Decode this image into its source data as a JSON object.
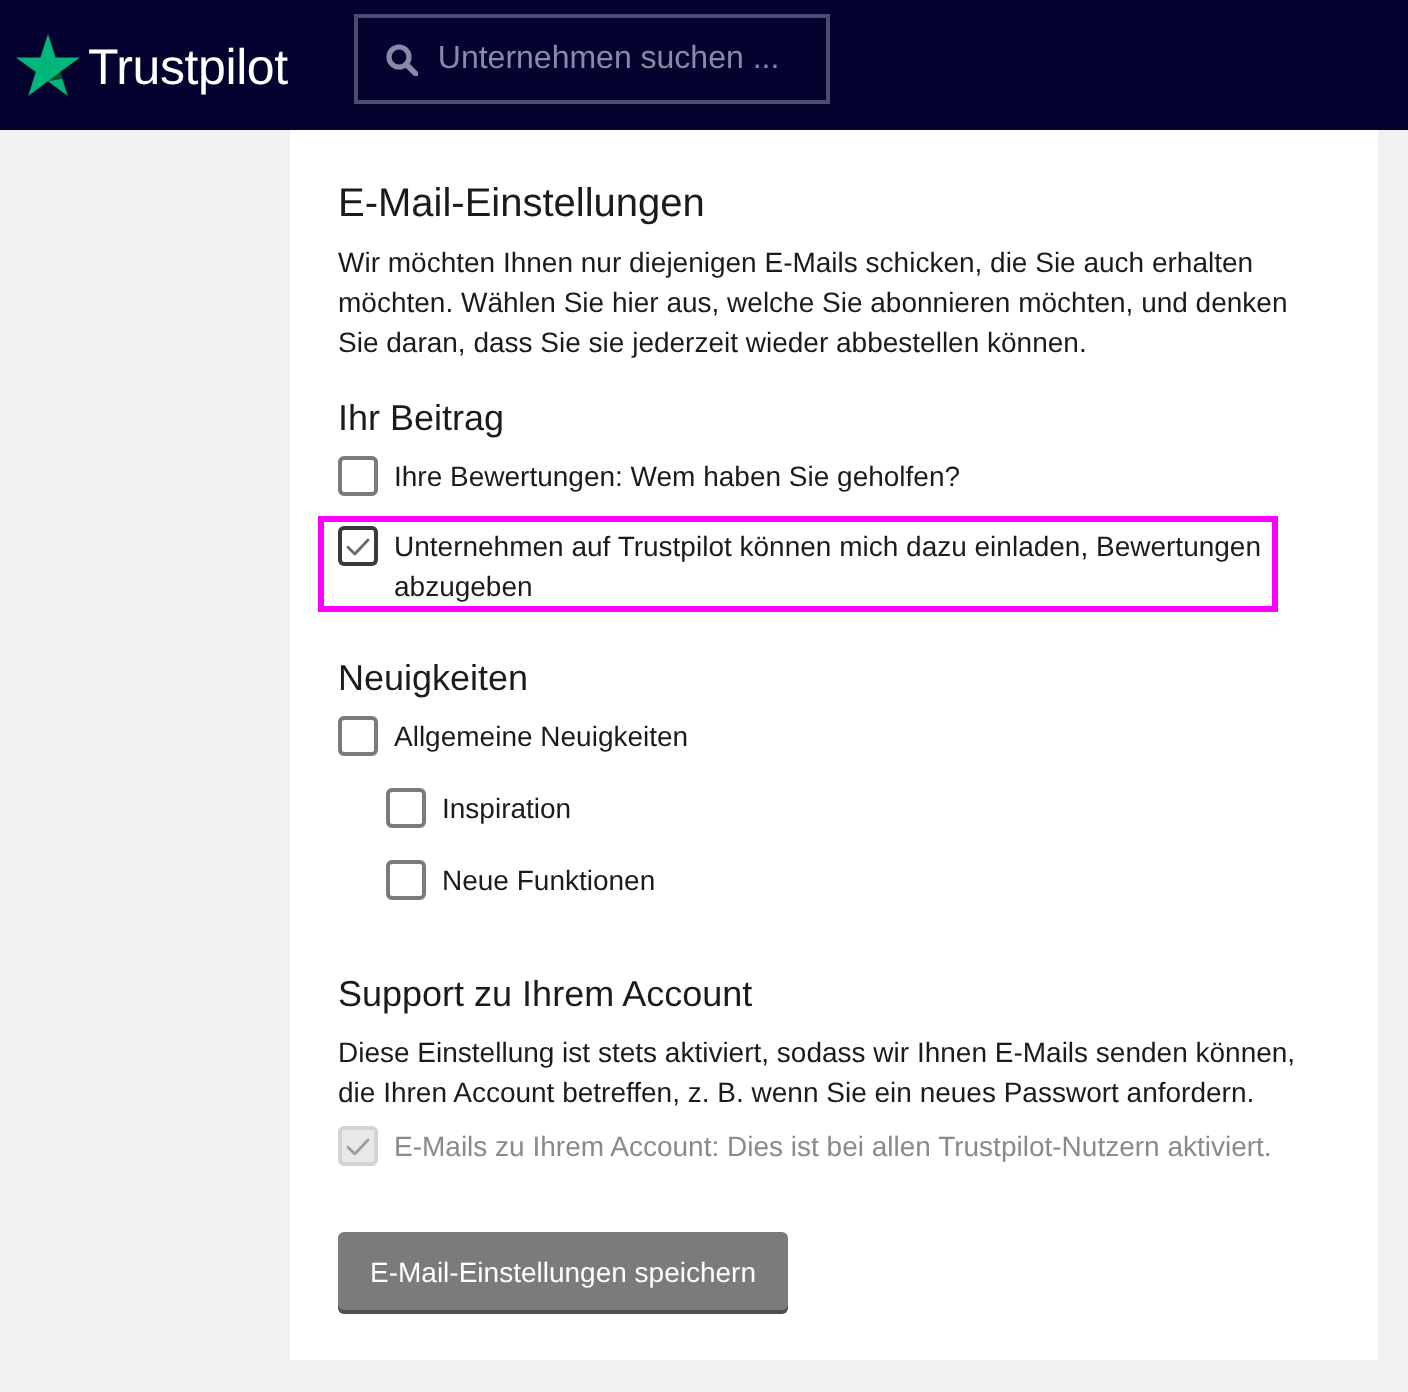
{
  "header": {
    "logo": "Trustpilot",
    "search": {
      "placeholder": "Unternehmen suchen ..."
    }
  },
  "settings": {
    "title": "E-Mail-Einstellungen",
    "intro": "Wir möchten Ihnen nur diejenigen E-Mails schicken, die Sie auch erhalten möchten. Wählen Sie hier aus, welche Sie abonnieren möchten, und denken Sie daran, dass Sie sie jederzeit wieder abbestellen können.",
    "sections": [
      {
        "heading": "Ihr Beitrag",
        "options": [
          {
            "label": "Ihre Bewertungen: Wem haben Sie geholfen?",
            "checked": false,
            "disabled": false,
            "highlighted": false
          },
          {
            "label": "Unternehmen auf Trustpilot können mich dazu einladen, Bewertungen abzugeben",
            "checked": true,
            "disabled": false,
            "highlighted": true
          }
        ]
      },
      {
        "heading": "Neuigkeiten",
        "options": [
          {
            "label": "Allgemeine Neuigkeiten",
            "checked": false,
            "disabled": false,
            "highlighted": false,
            "children": [
              {
                "label": "Inspiration",
                "checked": false,
                "disabled": false,
                "highlighted": false
              },
              {
                "label": "Neue Funktionen",
                "checked": false,
                "disabled": false,
                "highlighted": false
              }
            ]
          }
        ]
      },
      {
        "heading": "Support zu Ihrem Account",
        "description": "Diese Einstellung ist stets aktiviert, sodass wir Ihnen E-Mails senden können, die Ihren Account betreffen, z. B. wenn Sie ein neues Passwort anfordern.",
        "options": [
          {
            "label": "E-Mails zu Ihrem Account: Dies ist bei allen Trustpilot-Nutzern aktiviert.",
            "checked": true,
            "disabled": true,
            "highlighted": false
          }
        ]
      }
    ],
    "save_button": "E-Mail-Einstellungen speichern"
  }
}
